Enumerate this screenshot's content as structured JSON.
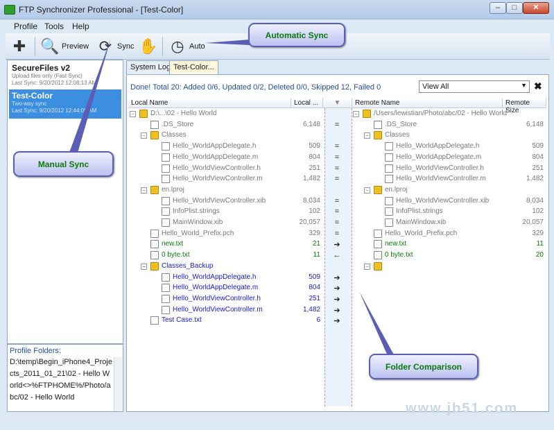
{
  "window": {
    "title": "FTP Synchronizer Professional - [Test-Color]",
    "min": "–",
    "max": "□",
    "close": "✕"
  },
  "menu": [
    {
      "label": "Profile"
    },
    {
      "label": "Tools"
    },
    {
      "label": "Help"
    }
  ],
  "toolbar": {
    "preview": "Preview",
    "sync": "Sync",
    "auto": "Auto"
  },
  "profiles": [
    {
      "name": "SecureFiles v2",
      "desc": "Upload files only (Fast Sync)",
      "last": "Last Sync: 9/20/2012 12:08:13 AM"
    },
    {
      "name": "Test-Color",
      "desc": "Two-way sync",
      "last": "Last Sync: 9/20/2012 12:44:09 AM"
    }
  ],
  "profile_folders": {
    "title": "Profile Folders:",
    "path": "D:\\temp\\Begin_iPhone4_Projects_2011_01_21\\02 - Hello World<>%FTPHOME%/Photo/abc/02 - Hello World"
  },
  "tabs": [
    {
      "label": "System Log"
    },
    {
      "label": "Test-Color..."
    }
  ],
  "status": "Done! Total 20: Added 0/6, Updated 0/2, Deleted 0/0, Skipped 12, Failed 0",
  "filter": {
    "value": "View All"
  },
  "columns": {
    "local_name": "Local Name",
    "local_size": "Local ...",
    "remote_name": "Remote Name",
    "remote_size": "Remote Size"
  },
  "local_rows": [
    {
      "name": "D:\\...\\02 - Hello World",
      "size": "",
      "cmp": "",
      "type": "folder",
      "color": "grey",
      "indent": 0,
      "exp": "−"
    },
    {
      "name": ".DS_Store",
      "size": "6,148",
      "cmp": "=",
      "type": "file",
      "color": "grey",
      "indent": 1
    },
    {
      "name": "Classes",
      "size": "",
      "cmp": "",
      "type": "folder",
      "color": "grey",
      "indent": 1,
      "exp": "−"
    },
    {
      "name": "Hello_WorldAppDelegate.h",
      "size": "509",
      "cmp": "=",
      "type": "file",
      "color": "grey",
      "indent": 2
    },
    {
      "name": "Hello_WorldAppDelegate.m",
      "size": "804",
      "cmp": "=",
      "type": "file",
      "color": "grey",
      "indent": 2
    },
    {
      "name": "Hello_WorldViewController.h",
      "size": "251",
      "cmp": "=",
      "type": "file",
      "color": "grey",
      "indent": 2
    },
    {
      "name": "Hello_WorldViewController.m",
      "size": "1,482",
      "cmp": "=",
      "type": "file",
      "color": "grey",
      "indent": 2
    },
    {
      "name": "en.lproj",
      "size": "",
      "cmp": "",
      "type": "folder",
      "color": "grey",
      "indent": 1,
      "exp": "−"
    },
    {
      "name": "Hello_WorldViewController.xib",
      "size": "8,034",
      "cmp": "=",
      "type": "file",
      "color": "grey",
      "indent": 2
    },
    {
      "name": "InfoPlist.strings",
      "size": "102",
      "cmp": "=",
      "type": "file",
      "color": "grey",
      "indent": 2
    },
    {
      "name": "MainWindow.xib",
      "size": "20,057",
      "cmp": "=",
      "type": "file",
      "color": "grey",
      "indent": 2
    },
    {
      "name": "Hello_World_Prefix.pch",
      "size": "329",
      "cmp": "=",
      "type": "file",
      "color": "grey",
      "indent": 1
    },
    {
      "name": "new.txt",
      "size": "21",
      "cmp": "➔",
      "type": "file",
      "color": "green",
      "indent": 1
    },
    {
      "name": "0 byte.txt",
      "size": "11",
      "cmp": "←",
      "type": "file",
      "color": "green",
      "indent": 1
    },
    {
      "name": "Classes_Backup",
      "size": "",
      "cmp": "",
      "type": "folder",
      "color": "blue",
      "indent": 1,
      "exp": "−"
    },
    {
      "name": "Hello_WorldAppDelegate.h",
      "size": "509",
      "cmp": "➔",
      "type": "file",
      "color": "blue",
      "indent": 2
    },
    {
      "name": "Hello_WorldAppDelegate.m",
      "size": "804",
      "cmp": "➔",
      "type": "file",
      "color": "blue",
      "indent": 2
    },
    {
      "name": "Hello_WorldViewController.h",
      "size": "251",
      "cmp": "➔",
      "type": "file",
      "color": "blue",
      "indent": 2
    },
    {
      "name": "Hello_WorldViewController.m",
      "size": "1,482",
      "cmp": "➔",
      "type": "file",
      "color": "blue",
      "indent": 2
    },
    {
      "name": "Test Case.txt",
      "size": "6",
      "cmp": "➔",
      "type": "file",
      "color": "blue",
      "indent": 1
    }
  ],
  "remote_rows": [
    {
      "name": "/Users/lewistian/Photo/abc/02 - Hello World",
      "size": "",
      "type": "folder",
      "color": "grey",
      "indent": 0,
      "exp": "−"
    },
    {
      "name": ".DS_Store",
      "size": "6,148",
      "type": "file",
      "color": "grey",
      "indent": 1
    },
    {
      "name": "Classes",
      "size": "",
      "type": "folder",
      "color": "grey",
      "indent": 1,
      "exp": "−"
    },
    {
      "name": "Hello_WorldAppDelegate.h",
      "size": "509",
      "type": "file",
      "color": "grey",
      "indent": 2
    },
    {
      "name": "Hello_WorldAppDelegate.m",
      "size": "804",
      "type": "file",
      "color": "grey",
      "indent": 2
    },
    {
      "name": "Hello_WorldViewController.h",
      "size": "251",
      "type": "file",
      "color": "grey",
      "indent": 2
    },
    {
      "name": "Hello_WorldViewController.m",
      "size": "1,482",
      "type": "file",
      "color": "grey",
      "indent": 2
    },
    {
      "name": "en.lproj",
      "size": "",
      "type": "folder",
      "color": "grey",
      "indent": 1,
      "exp": "−"
    },
    {
      "name": "Hello_WorldViewController.xib",
      "size": "8,034",
      "type": "file",
      "color": "grey",
      "indent": 2
    },
    {
      "name": "InfoPlist.strings",
      "size": "102",
      "type": "file",
      "color": "grey",
      "indent": 2
    },
    {
      "name": "MainWindow.xib",
      "size": "20,057",
      "type": "file",
      "color": "grey",
      "indent": 2
    },
    {
      "name": "Hello_World_Prefix.pch",
      "size": "329",
      "type": "file",
      "color": "grey",
      "indent": 1
    },
    {
      "name": "new.txt",
      "size": "11",
      "type": "file",
      "color": "green",
      "indent": 1
    },
    {
      "name": "0 byte.txt",
      "size": "20",
      "type": "file",
      "color": "green",
      "indent": 1
    },
    {
      "name": "",
      "size": "",
      "type": "folder",
      "color": "grey",
      "indent": 1,
      "exp": "−"
    }
  ],
  "callouts": {
    "auto": "Automatic Sync",
    "manual": "Manual Sync",
    "folder": "Folder Comparison"
  },
  "watermark": "www.jb51.com",
  "colors": {
    "accent_blue": "#1f4fa8",
    "selected_profile": "#3c8ee0",
    "added_green": "#0a7a0a",
    "new_blue": "#1919c8",
    "callout_border": "#5a5fb5"
  }
}
